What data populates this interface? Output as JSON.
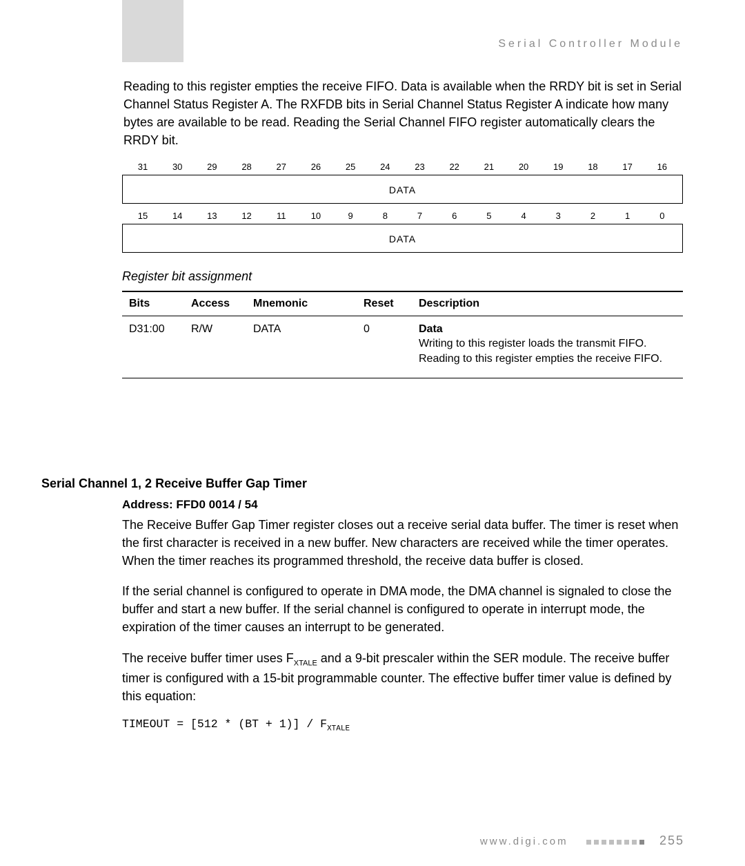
{
  "header": "Serial Controller Module",
  "intro": "Reading to this register empties the receive FIFO. Data is available when the RRDY bit is set in Serial Channel Status Register A. The RXFDB bits in Serial Channel Status Register A indicate how many bytes are available to be read. Reading the Serial Channel FIFO register automatically clears the RRDY bit.",
  "bit_diagram": {
    "row1_bits": [
      "31",
      "30",
      "29",
      "28",
      "27",
      "26",
      "25",
      "24",
      "23",
      "22",
      "21",
      "20",
      "19",
      "18",
      "17",
      "16"
    ],
    "row1_label": "DATA",
    "row2_bits": [
      "15",
      "14",
      "13",
      "12",
      "11",
      "10",
      "9",
      "8",
      "7",
      "6",
      "5",
      "4",
      "3",
      "2",
      "1",
      "0"
    ],
    "row2_label": "DATA"
  },
  "reg_assign_hdr": "Register bit assignment",
  "regtable": {
    "headers": [
      "Bits",
      "Access",
      "Mnemonic",
      "Reset",
      "Description"
    ],
    "row": {
      "bits": "D31:00",
      "access": "R/W",
      "mnemonic": "DATA",
      "reset": "0",
      "desc_title": "Data",
      "desc_lines": [
        "Writing to this register loads the transmit FIFO.",
        "Reading to this register empties the receive FIFO."
      ]
    }
  },
  "section2": {
    "title": "Serial Channel 1, 2 Receive Buffer Gap Timer",
    "address": "Address: FFD0 0014 / 54",
    "para1": "The Receive Buffer Gap Timer register closes out a receive serial data buffer. The timer is reset when the first character is received in a new buffer. New characters are received while the timer operates. When the timer reaches its programmed threshold, the receive data buffer is closed.",
    "para2": "If the serial channel is configured to operate in DMA mode, the DMA channel is signaled to close the buffer and start a new buffer. If the serial channel is configured to operate in interrupt mode, the expiration of the timer causes an interrupt to be generated.",
    "para3_pre": "The receive buffer timer uses F",
    "para3_sub": "XTALE",
    "para3_post": " and a 9-bit prescaler within the SER module. The receive buffer timer is configured with a 15-bit programmable counter. The effective buffer timer value is defined by this equation:",
    "equation_pre": "TIMEOUT = [512 * (BT + 1)] / F",
    "equation_sub": "XTALE"
  },
  "footer": {
    "url": "www.digi.com",
    "page": "255"
  }
}
